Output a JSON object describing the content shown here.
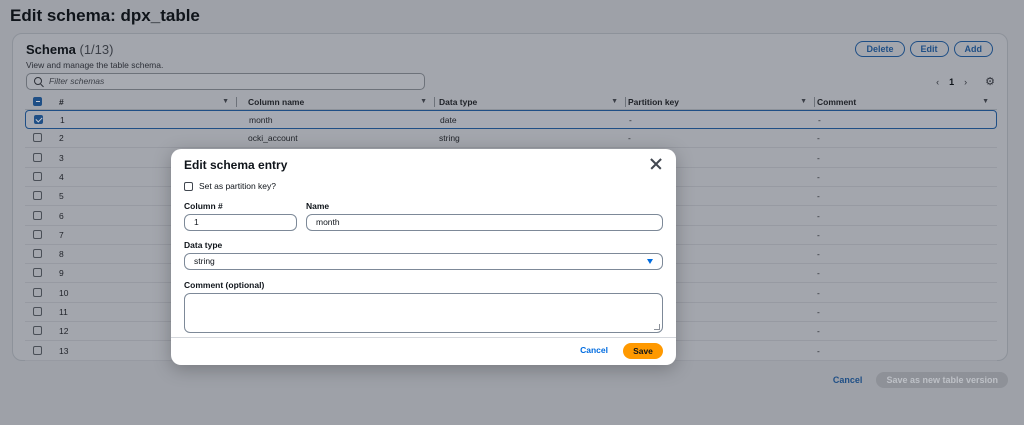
{
  "page": {
    "title": "Edit schema: dpx_table"
  },
  "schema": {
    "title": "Schema",
    "count": "(1/13)",
    "description": "View and manage the table schema.",
    "buttons": {
      "delete": "Delete",
      "edit": "Edit",
      "add": "Add"
    },
    "filter_placeholder": "Filter schemas",
    "pager": {
      "prev": "‹",
      "page": "1",
      "next": "›"
    },
    "columns": [
      "#",
      "Column name",
      "Data type",
      "Partition key",
      "Comment"
    ],
    "rows": [
      {
        "num": "1",
        "name": "month",
        "type": "date",
        "partition": "-",
        "comment": "-"
      },
      {
        "num": "2",
        "name": "ocki_account",
        "type": "string",
        "partition": "-",
        "comment": "-"
      },
      {
        "num": "3",
        "name": "",
        "type": "",
        "partition": "",
        "comment": "-"
      },
      {
        "num": "4",
        "name": "",
        "type": "",
        "partition": "",
        "comment": "-"
      },
      {
        "num": "5",
        "name": "",
        "type": "",
        "partition": "",
        "comment": "-"
      },
      {
        "num": "6",
        "name": "",
        "type": "",
        "partition": "",
        "comment": "-"
      },
      {
        "num": "7",
        "name": "",
        "type": "",
        "partition": "",
        "comment": "-"
      },
      {
        "num": "8",
        "name": "",
        "type": "",
        "partition": "",
        "comment": "-"
      },
      {
        "num": "9",
        "name": "",
        "type": "",
        "partition": "",
        "comment": "-"
      },
      {
        "num": "10",
        "name": "",
        "type": "",
        "partition": "",
        "comment": "-"
      },
      {
        "num": "11",
        "name": "",
        "type": "",
        "partition": "",
        "comment": "-"
      },
      {
        "num": "12",
        "name": "",
        "type": "",
        "partition": "",
        "comment": "-"
      },
      {
        "num": "13",
        "name": "",
        "type": "",
        "partition": "",
        "comment": "-"
      }
    ]
  },
  "footer": {
    "cancel": "Cancel",
    "save_version": "Save as new table version"
  },
  "modal": {
    "title": "Edit schema entry",
    "partition_checkbox": "Set as partition key?",
    "column_label": "Column #",
    "column_value": "1",
    "name_label": "Name",
    "name_value": "month",
    "type_label": "Data type",
    "type_value": "string",
    "comment_label": "Comment (optional)",
    "cancel": "Cancel",
    "save": "Save"
  },
  "colors": {
    "accent": "#006ce0",
    "primary_button": "#ff9900",
    "overlay_link": "#1f4f86"
  }
}
